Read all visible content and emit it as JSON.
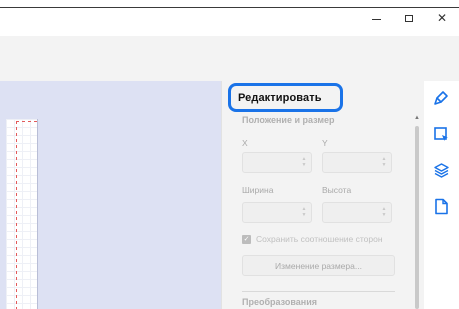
{
  "window": {
    "minimize_glyph": "–",
    "close_glyph": "✕"
  },
  "panel": {
    "title": "Редактировать",
    "position_section": "Положение и размер",
    "x_label": "X",
    "y_label": "Y",
    "width_label": "Ширина",
    "height_label": "Высота",
    "keep_ratio_label": "Сохранить соотношение сторон",
    "resize_button": "Изменение размера...",
    "transform_section": "Преобразования",
    "x_value": "",
    "y_value": "",
    "width_value": "",
    "height_value": ""
  },
  "rail": {
    "items": [
      "edit-brush-icon",
      "selection-icon",
      "layers-icon",
      "page-icon"
    ],
    "active_color": "#1a73e8"
  },
  "colors": {
    "highlight": "#1a73e8",
    "canvas": "#dde1f3"
  }
}
